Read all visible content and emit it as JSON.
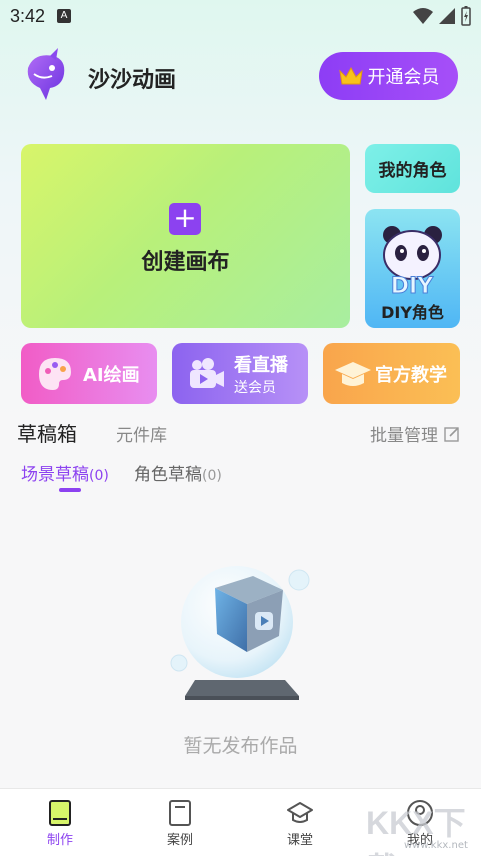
{
  "status_bar": {
    "time": "3:42",
    "notif_icon": "A"
  },
  "header": {
    "app_name": "沙沙动画",
    "vip_label": "开通会员"
  },
  "cards": {
    "create_canvas": "创建画布",
    "my_roles": "我的角色",
    "diy_roles": "DIY角色"
  },
  "features": {
    "ai_draw": "AI绘画",
    "live_title": "看直播",
    "live_sub": "送会员",
    "tutorial": "官方教学"
  },
  "tabs": {
    "drafts": "草稿箱",
    "components": "元件库",
    "batch_manage": "批量管理"
  },
  "sub_tabs": {
    "scene": "场景草稿",
    "scene_count": "(0)",
    "role": "角色草稿",
    "role_count": "(0)"
  },
  "empty_text": "暂无发布作品",
  "bottom_nav": {
    "make": "制作",
    "cases": "案例",
    "classroom": "课堂",
    "mine": "我的"
  },
  "watermark": {
    "text": "KKX下载",
    "sub": "www.kkx.net"
  },
  "colors": {
    "accent": "#8c42f0",
    "create_card": "#c6f27a",
    "roles_card": "#6fe9e2"
  }
}
